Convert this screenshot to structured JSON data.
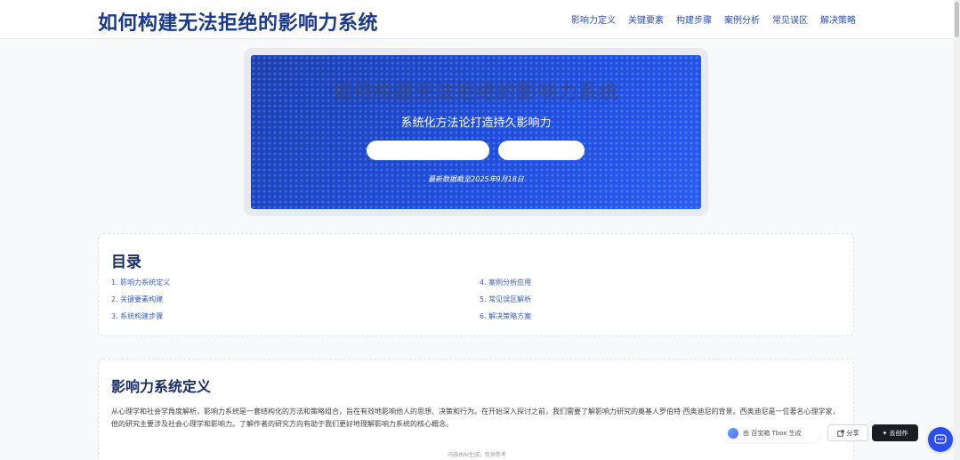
{
  "header": {
    "title": "如何构建无法拒绝的影响力系统",
    "nav": [
      "影响力定义",
      "关键要素",
      "构建步骤",
      "案例分析",
      "常见误区",
      "解决策略"
    ]
  },
  "hero": {
    "title": "如何构建无法拒绝的影响力系统",
    "subtitle": "系统化方法论打造持久影响力",
    "note": "最新数据截至2025年9月18日"
  },
  "toc": {
    "heading": "目录",
    "items": [
      "1. 影响力系统定义",
      "2. 关键要素构建",
      "3. 系统构建步骤",
      "4. 案例分析应用",
      "5. 常见误区解析",
      "6. 解决策略方案"
    ]
  },
  "definition": {
    "heading": "影响力系统定义",
    "body": "从心理学和社会学角度解析，影响力系统是一套结构化的方法和策略组合，旨在有效地影响他人的思想、决策和行为。在开始深入探讨之前，我们需要了解影响力研究的奠基人罗伯特·西奥迪尼的背景。西奥迪尼是一位著名心理学家，他的研究主要涉及社会心理学和影响力。了解作者的研究方向有助于我们更好地理解影响力系统的核心概念。"
  },
  "footer": {
    "note": "内容由AI生成，仅供参考"
  },
  "tools": {
    "tbox_label": "由 百宝箱 Tbox 生成",
    "share_label": "分享",
    "create_label": "✦ 去创作"
  },
  "colors": {
    "accent": "#1a3a8c",
    "hero": "#1f4fe0",
    "link": "#3a5fc0"
  }
}
